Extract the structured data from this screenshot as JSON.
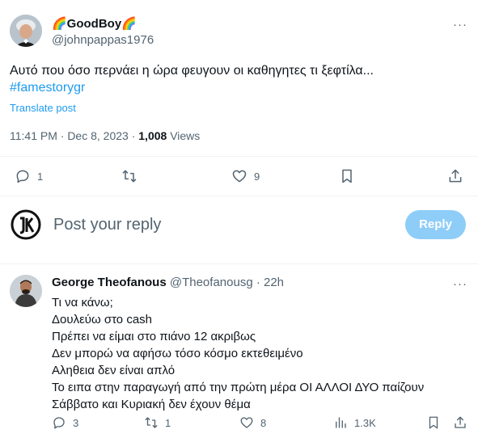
{
  "post": {
    "author_name": "🌈GoodBoy🌈",
    "author_handle": "@johnpappas1976",
    "text": "Αυτό που όσο περνάει η ώρα φευγουν οι καθηγητες τι ξεφτίλα...",
    "hashtag": "#famestorygr",
    "translate": "Translate post",
    "time": "11:41 PM · Dec 8, 2023 · ",
    "views_count": "1,008",
    "views_label": " Views",
    "more": "···",
    "actions": {
      "replies": "1",
      "reposts": "",
      "likes": "9"
    }
  },
  "composer": {
    "placeholder": "Post your reply",
    "button": "Reply"
  },
  "reply": {
    "author_name": "George Theofanous",
    "author_handle": "@Theofanousg",
    "dot": " · ",
    "age": "22h",
    "more": "···",
    "lines": [
      "Τι να κάνω;",
      "Δουλεύω στο cash",
      "Πρέπει να είμαι στο πιάνο 12 ακριβως",
      "Δεν μπορώ να αφήσω τόσο κόσμο εκτεθειμένο",
      "Αληθεια δεν είναι απλό",
      "Το ειπα στην παραγωγή από την πρώτη μέρα ΟΙ ΑΛΛΟΙ ΔΥΟ παίζουν",
      "Σάββατο και Κυριακή δεν έχουν θέμα"
    ],
    "actions": {
      "replies": "3",
      "reposts": "1",
      "likes": "8",
      "views": "1.3K"
    }
  },
  "colors": {
    "accent": "#1d9bf0",
    "muted": "#536471",
    "reply_button": "#8ecdf8"
  }
}
